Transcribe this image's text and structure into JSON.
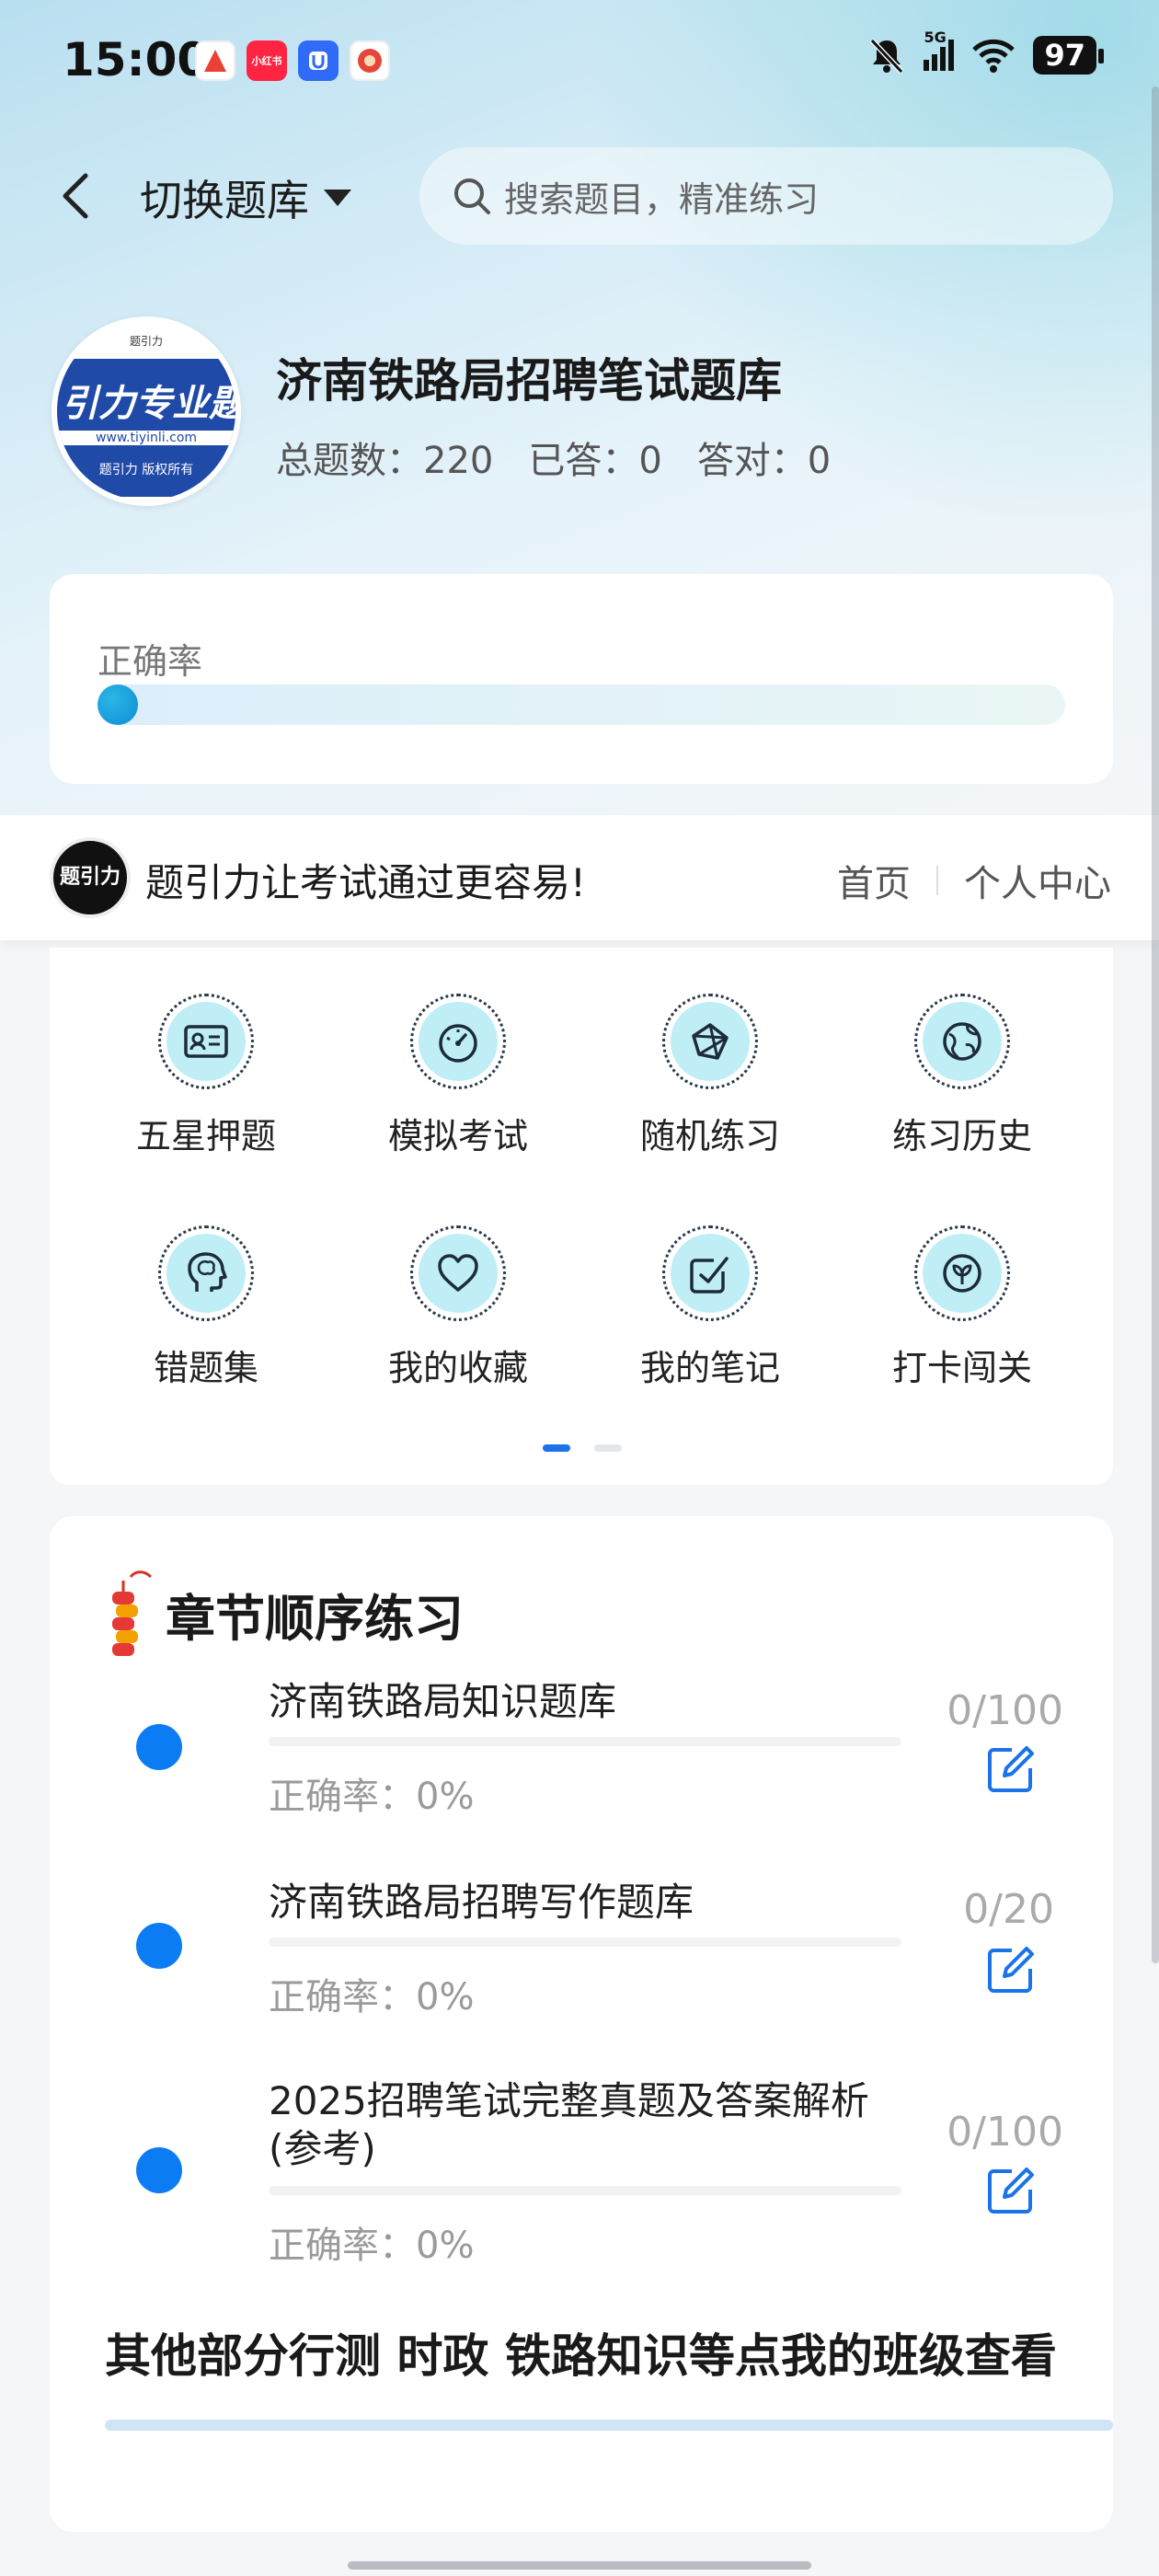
{
  "status_bar": {
    "time": "15:00",
    "battery": "97",
    "network": "5G",
    "notification_apps": [
      {
        "name": "app-a",
        "color": "#e94235",
        "glyph": "A"
      },
      {
        "name": "xiaohongshu",
        "color": "#ff2442",
        "glyph": "小红书"
      },
      {
        "name": "app-blue",
        "color": "#2f6bf6",
        "glyph": "U"
      },
      {
        "name": "app-red",
        "color": "#e5463a",
        "glyph": "福"
      }
    ]
  },
  "header": {
    "switch_label": "切换题库",
    "search_placeholder": "搜索题目，精准练习"
  },
  "bank": {
    "logo_text": "引力专业题",
    "logo_url": "www.tiyinli.com",
    "logo_copy": "题引力 版权所有",
    "logo_top": "题引力",
    "title": "济南铁路局招聘笔试题库",
    "total_label": "总题数：220",
    "answered_label": "已答：0",
    "correct_label": "答对：0"
  },
  "accuracy": {
    "label": "正确率",
    "value": 0
  },
  "brand": {
    "logo_text": "题引力",
    "slogan": "题引力让考试通过更容易!",
    "nav_home": "首页",
    "nav_profile": "个人中心"
  },
  "functions": [
    {
      "label": "五星押题",
      "icon": "id-card-icon"
    },
    {
      "label": "模拟考试",
      "icon": "gauge-icon"
    },
    {
      "label": "随机练习",
      "icon": "network-icon"
    },
    {
      "label": "练习历史",
      "icon": "globe-icon"
    },
    {
      "label": "错题集",
      "icon": "brain-head-icon"
    },
    {
      "label": "我的收藏",
      "icon": "heart-icon"
    },
    {
      "label": "我的笔记",
      "icon": "checkbox-icon"
    },
    {
      "label": "打卡闯关",
      "icon": "leaf-badge-icon"
    }
  ],
  "pager": {
    "pages": 2,
    "active": 0
  },
  "chapters": {
    "heading": "章节顺序练习",
    "items": [
      {
        "title": "济南铁路局知识题库",
        "accuracy": "正确率：0%",
        "count": "0/100",
        "progress": 0
      },
      {
        "title": "济南铁路局招聘写作题库",
        "accuracy": "正确率：0%",
        "count": "0/20",
        "progress": 0
      },
      {
        "title": "2025招聘笔试完整真题及答案解析(参考)",
        "accuracy": "正确率：0%",
        "count": "0/100",
        "progress": 0
      }
    ],
    "footer_link": "其他部分行测 时政 铁路知识等点我的班级查看"
  },
  "colors": {
    "accent": "#0b7cf3",
    "icon_fill": "#bfeef7"
  }
}
